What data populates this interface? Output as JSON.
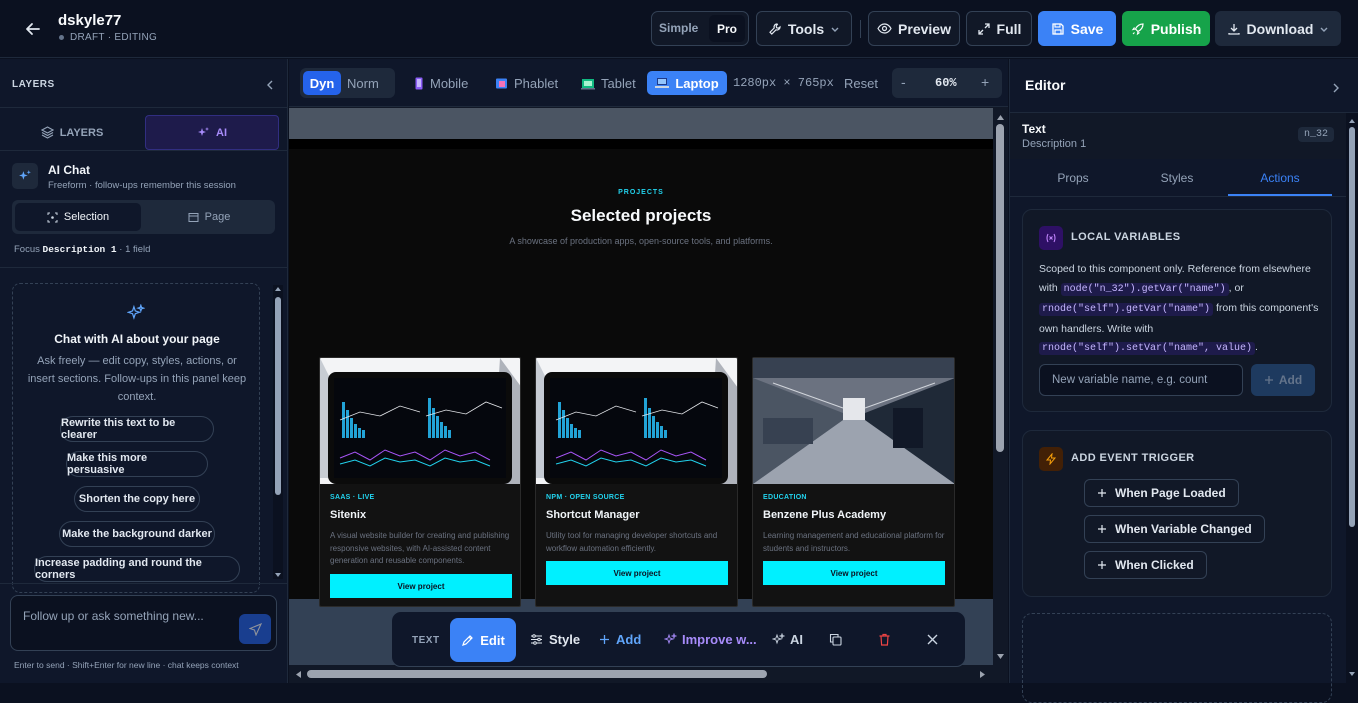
{
  "header": {
    "project_name": "dskyle77",
    "status": "DRAFT · EDITING",
    "mode_simple": "Simple",
    "mode_pro": "Pro",
    "tools": "Tools",
    "preview": "Preview",
    "full": "Full",
    "save": "Save",
    "publish": "Publish",
    "download": "Download"
  },
  "left": {
    "title": "LAYERS",
    "tab_layers": "LAYERS",
    "tab_ai": "AI",
    "chat_title": "AI Chat",
    "chat_sub": "Freeform · follow-ups remember this session",
    "scope_selection": "Selection",
    "scope_page": "Page",
    "focus_prefix": "Focus",
    "focus_name": "Description 1",
    "focus_suffix": "· 1 field",
    "empty_title": "Chat with AI about your page",
    "empty_desc": "Ask freely — edit copy, styles, actions, or insert sections. Follow-ups in this panel keep context.",
    "suggestions": [
      "Rewrite this text to be clearer",
      "Make this more persuasive",
      "Shorten the copy here",
      "Make the background darker",
      "Increase padding and round the corners"
    ],
    "input_placeholder": "Follow up or ask something new...",
    "hint": "Enter to send · Shift+Enter for new line · chat keeps context"
  },
  "toolbar": {
    "dyn": "Dyn",
    "norm": "Norm",
    "mobile": "Mobile",
    "phablet": "Phablet",
    "tablet": "Tablet",
    "laptop": "Laptop",
    "dimensions": "1280px × 765px",
    "reset": "Reset",
    "zoom_minus": "-",
    "zoom": "60%",
    "zoom_plus": "+"
  },
  "canvas": {
    "eyebrow": "PROJECTS",
    "heading": "Selected projects",
    "subheading": "A showcase of production apps, open-source tools, and platforms.",
    "cards": [
      {
        "tag": "SAAS · LIVE",
        "title": "Sitenix",
        "desc": "A visual website builder for creating and publishing responsive websites, with AI-assisted content generation and reusable components.",
        "button": "View project"
      },
      {
        "tag": "NPM · OPEN SOURCE",
        "title": "Shortcut Manager",
        "desc": "Utility tool for managing developer shortcuts and workflow automation efficiently.",
        "button": "View project"
      },
      {
        "tag": "EDUCATION",
        "title": "Benzene Plus Academy",
        "desc": "Learning management and educational platform for students and instructors.",
        "button": "View project"
      }
    ]
  },
  "floating": {
    "type": "TEXT",
    "edit": "Edit",
    "style": "Style",
    "add": "Add",
    "improve": "Improve w...",
    "ai": "AI"
  },
  "editor": {
    "title": "Editor",
    "element_type": "Text",
    "element_name": "Description 1",
    "node_id": "n_32",
    "tab_props": "Props",
    "tab_styles": "Styles",
    "tab_actions": "Actions",
    "local_vars_title": "LOCAL VARIABLES",
    "lv_text1": "Scoped to this component only. Reference from elsewhere with",
    "lv_code1": "node(\"n_32\").getVar(\"name\")",
    "lv_text2": ", or",
    "lv_code2": "rnode(\"self\").getVar(\"name\")",
    "lv_text3": "from this component's own handlers. Write with",
    "lv_code3": "rnode(\"self\").setVar(\"name\", value)",
    "lv_text4": ".",
    "var_placeholder": "New variable name, e.g. count",
    "add_var": "Add",
    "trigger_title": "ADD EVENT TRIGGER",
    "triggers": [
      "When Page Loaded",
      "When Variable Changed",
      "When Clicked"
    ]
  },
  "colors": {
    "accent": "#3b82f6",
    "publish": "#16a34a",
    "cyan": "#00f0ff",
    "purple": "#a78bfa"
  }
}
